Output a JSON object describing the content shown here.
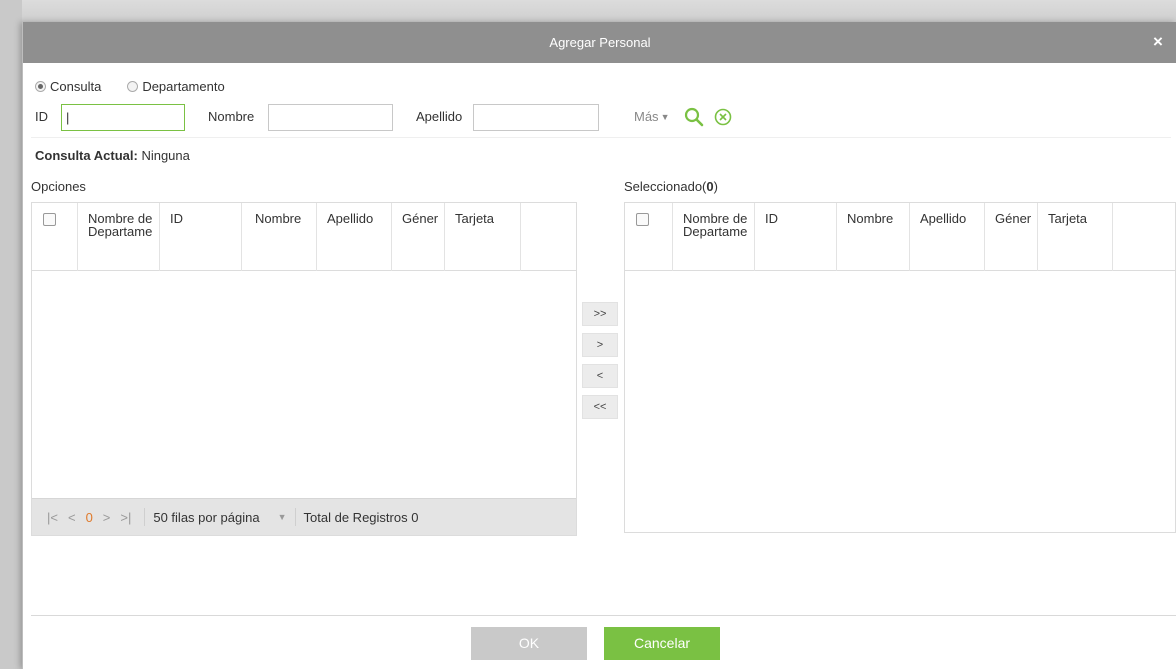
{
  "dialog": {
    "title": "Agregar Personal",
    "close_label": "×"
  },
  "mode": {
    "options": [
      {
        "label": "Consulta",
        "checked": true
      },
      {
        "label": "Departamento",
        "checked": false
      }
    ]
  },
  "filters": {
    "id_label": "ID",
    "id_value": "|",
    "nombre_label": "Nombre",
    "apellido_label": "Apellido",
    "mas_label": "Más",
    "search_icon": "search-icon",
    "clear_icon": "clear-circle-icon"
  },
  "consulta_actual": {
    "label": "Consulta Actual:",
    "value": "Ninguna"
  },
  "opciones": {
    "label": "Opciones",
    "columns": [
      "Nombre de Departame",
      "ID",
      "Nombre",
      "Apellido",
      "Géner",
      "Tarjeta"
    ]
  },
  "seleccionado": {
    "label": "Seleccionado(",
    "count": "0",
    "label_end": ")",
    "columns": [
      "Nombre de Departame",
      "ID",
      "Nombre",
      "Apellido",
      "Géner",
      "Tarjeta"
    ]
  },
  "pager": {
    "first": "|<",
    "prev": "<",
    "page": "0",
    "next": ">",
    "last": ">|",
    "rows_per_page": "50 filas por página",
    "dropdown": "▼",
    "total": "Total de Registros 0"
  },
  "transfer": {
    "all_right": ">>",
    "right": ">",
    "left": "<",
    "all_left": "<<"
  },
  "buttons": {
    "ok": "OK",
    "cancel": "Cancelar"
  },
  "colors": {
    "accent": "#7ac143",
    "title_bar": "#8f8f8f",
    "disabled_button": "#c9c9c9",
    "page_current": "#e07a2b"
  }
}
